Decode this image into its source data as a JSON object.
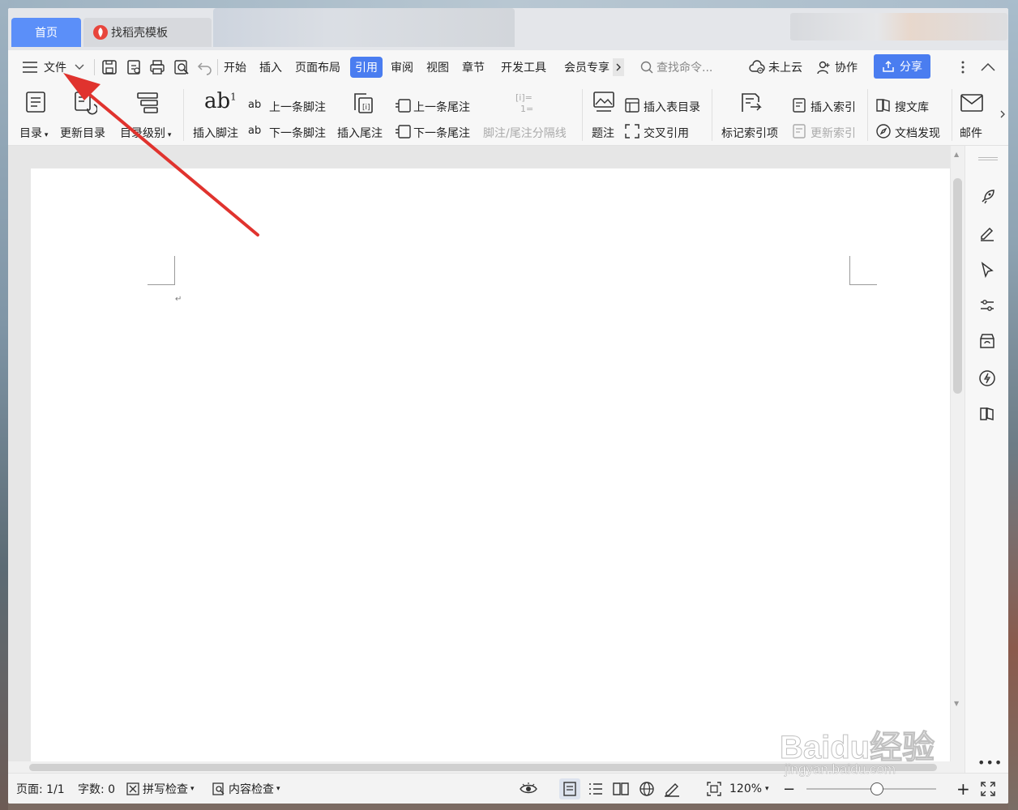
{
  "tabs": {
    "home": "首页",
    "template": "找稻壳模板"
  },
  "menu": {
    "file": "文件",
    "items": [
      "开始",
      "插入",
      "页面布局",
      "引用",
      "审阅",
      "视图",
      "章节",
      "开发工具",
      "会员专享"
    ],
    "active_index": 3,
    "search_placeholder": "查找命令...",
    "cloud": "未上云",
    "collab": "协作",
    "share": "分享"
  },
  "ribbon": {
    "toc": "目录",
    "update_toc": "更新目录",
    "toc_level": "目录级别",
    "insert_footnote": "插入脚注",
    "prev_footnote": "上一条脚注",
    "next_footnote": "下一条脚注",
    "insert_endnote": "插入尾注",
    "prev_endnote": "上一条尾注",
    "next_endnote": "下一条尾注",
    "separator_line": "脚注/尾注分隔线",
    "caption": "题注",
    "insert_table_toc": "插入表目录",
    "cross_ref": "交叉引用",
    "mark_index": "标记索引项",
    "insert_index": "插入索引",
    "update_index": "更新索引",
    "search_library": "搜文库",
    "doc_discover": "文档发现",
    "mail": "邮件"
  },
  "status": {
    "page": "页面: 1/1",
    "word_count": "字数: 0",
    "spell_check": "拼写检查",
    "content_check": "内容检查",
    "zoom": "120%"
  },
  "watermark": {
    "brand": "Baidu经验",
    "url": "jingyan.baidu.com"
  },
  "colors": {
    "accent": "#4a7df0",
    "home_tab": "#5b8ff9",
    "arrow": "#e0332e"
  },
  "icons": [
    "rocket-icon",
    "pen-icon",
    "cursor-icon",
    "sliders-icon",
    "store-icon",
    "lightning-icon",
    "book-icon"
  ]
}
